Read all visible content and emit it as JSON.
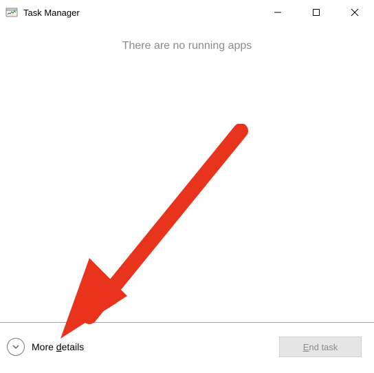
{
  "titlebar": {
    "title": "Task Manager"
  },
  "content": {
    "empty_message": "There are no running apps"
  },
  "footer": {
    "more_details_prefix": "More ",
    "more_details_accel": "d",
    "more_details_suffix": "etails",
    "end_task_accel": "E",
    "end_task_suffix": "nd task"
  },
  "colors": {
    "arrow": "#E8341C"
  }
}
